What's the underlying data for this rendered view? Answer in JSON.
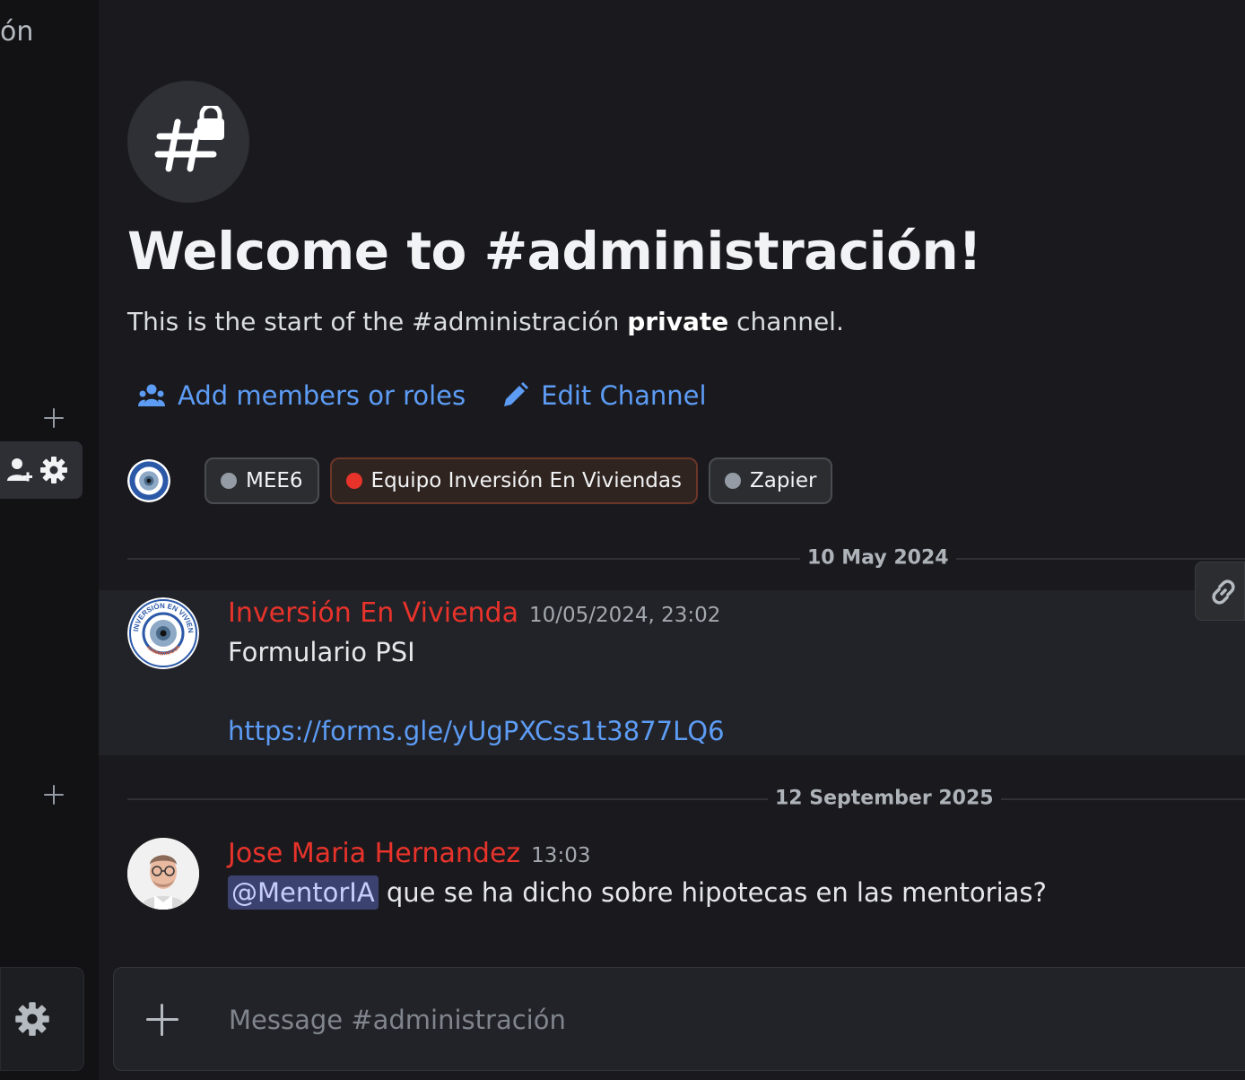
{
  "sidebar": {
    "channel_fragment": "ón"
  },
  "channel": {
    "welcome_title": "Welcome to #administración!",
    "sub_prefix": "This is the start of the #administración ",
    "sub_bold": "private",
    "sub_suffix": " channel.",
    "actions": {
      "add_members": "Add members or roles",
      "edit_channel": "Edit Channel"
    },
    "roles": [
      {
        "label": "MEE6",
        "color": "#949ba4"
      },
      {
        "label": "Equipo Inversión En Viviendas",
        "color": "#e8332b"
      },
      {
        "label": "Zapier",
        "color": "#949ba4"
      }
    ]
  },
  "messages": {
    "date1": "10 May 2024",
    "msg1": {
      "author": "Inversión En Vivienda",
      "time": "10/05/2024, 23:02",
      "text": "Formulario PSI",
      "link": "https://forms.gle/yUgPXCss1t3877LQ6",
      "avatar_ring_text": "INVERSIÓN EN VIVIENDA",
      "avatar_badge_text": "ADMINISTRADOR"
    },
    "date2": "12 September 2025",
    "msg2": {
      "author": "Jose Maria Hernandez",
      "time": "13:03",
      "mention": "@MentorIA",
      "text": " que se ha dicho sobre hipotecas en las mentorias?"
    }
  },
  "composer": {
    "placeholder": "Message #administración"
  },
  "colors": {
    "accent_link": "#5d9cf5",
    "author_red": "#e8332b",
    "mention_bg": "#3c4270"
  }
}
